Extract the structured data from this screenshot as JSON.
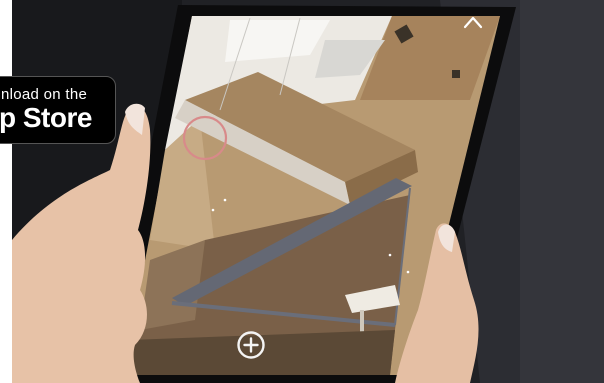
{
  "store_badge": {
    "line1": "nload on the",
    "line2": "p Store"
  },
  "ar_app": {
    "collapse_icon": "chevron-up-icon",
    "add_icon": "plus-circle-icon",
    "reticle_color": "#d88a8a"
  }
}
